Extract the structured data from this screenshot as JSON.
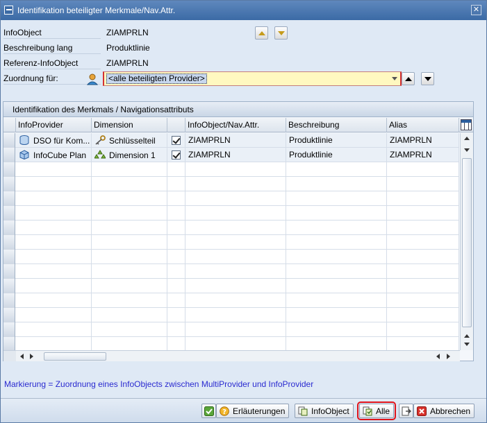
{
  "window": {
    "title": "Identifikation beteiligter Merkmale/Nav.Attr.",
    "close": "✕"
  },
  "fields": [
    {
      "label": "InfoObject",
      "value": "ZIAMPRLN"
    },
    {
      "label": "Beschreibung lang",
      "value": "Produktlinie"
    },
    {
      "label": "Referenz-InfoObject",
      "value": "ZIAMPRLN"
    },
    {
      "label": "Zuordnung für:",
      "value": "<alle beteiligten Provider>"
    }
  ],
  "table": {
    "title": "Identifikation des Merkmals / Navigationsattributs",
    "columns": [
      "InfoProvider",
      "Dimension",
      "",
      "InfoObject/Nav.Attr.",
      "Beschreibung",
      "Alias"
    ],
    "rows": [
      {
        "provider": "DSO für Kom...",
        "provider_icon": "dso-icon",
        "dimension": "Schlüsselteil",
        "dimension_icon": "key-icon",
        "checked": true,
        "infoobject": "ZIAMPRLN",
        "beschreibung": "Produktlinie",
        "alias": "ZIAMPRLN"
      },
      {
        "provider": "InfoCube Plan",
        "provider_icon": "cube-icon",
        "dimension": "Dimension 1",
        "dimension_icon": "dimension-icon",
        "checked": true,
        "infoobject": "ZIAMPRLN",
        "beschreibung": "Produktlinie",
        "alias": "ZIAMPRLN"
      }
    ]
  },
  "hint": "Markierung = Zuordnung eines InfoObjects zwischen MultiProvider und InfoProvider",
  "buttons": {
    "erlaeuterungen": "Erläuterungen",
    "infoobject": "InfoObject",
    "alle": "Alle",
    "abbrechen": "Abbrechen"
  },
  "colors": {
    "title_bar": "#4a76ae",
    "highlight_outline": "#e0141b",
    "hint_text": "#2a2ad0",
    "combo_bg": "#fff8c0"
  }
}
